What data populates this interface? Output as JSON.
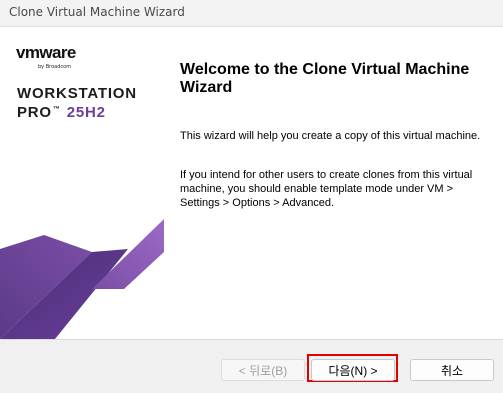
{
  "window": {
    "title": "Clone Virtual Machine Wizard"
  },
  "banner": {
    "logo_vm": "vmware",
    "logo_by": "by Broadcom",
    "product_line1": "WORKSTATION",
    "product_line2": "PRO",
    "product_tm": "™",
    "product_version": "25H2",
    "colors": {
      "purple_dark": "#5b3a8a",
      "purple_mid": "#7b4ea6",
      "purple_light": "#9a6ac4"
    }
  },
  "main": {
    "title": "Welcome to the Clone Virtual Machine Wizard",
    "paragraph1": "This wizard will help you create a copy of this virtual machine.",
    "paragraph2": "If you intend for other users to create clones from this virtual machine, you should enable template mode under VM > Settings > Options > Advanced."
  },
  "buttons": {
    "back_label": "< 뒤로(B)",
    "next_label": "다음(N) >",
    "cancel_label": "취소"
  }
}
